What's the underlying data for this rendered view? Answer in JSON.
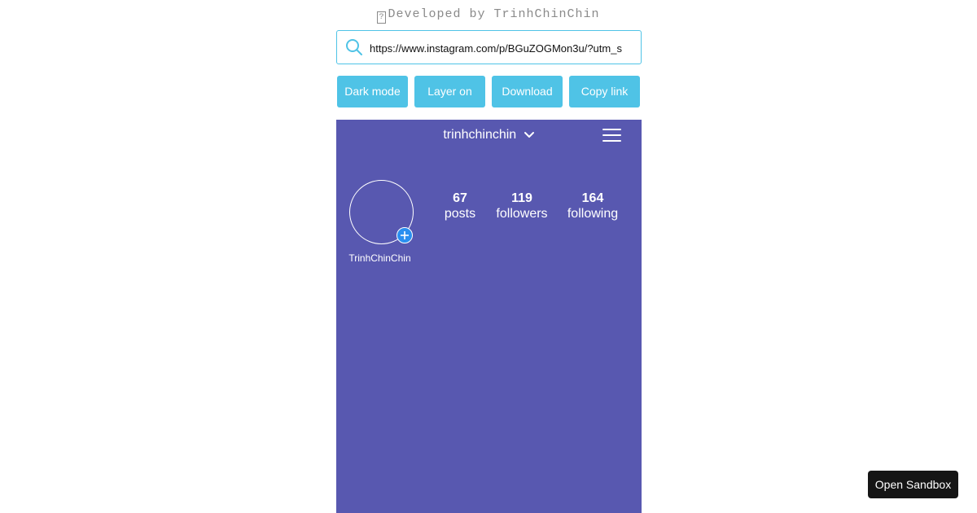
{
  "credit": {
    "glyph": "?",
    "text": "Developed by TrinhChinChin"
  },
  "url_bar": {
    "icon": "search-icon",
    "value": "https://www.instagram.com/p/BGuZOGMon3u/?utm_s",
    "accent_color": "#4fc3e6"
  },
  "toolbar": {
    "buttons": [
      {
        "label": "Dark mode"
      },
      {
        "label": "Layer on"
      },
      {
        "label": "Download"
      },
      {
        "label": "Copy link"
      }
    ]
  },
  "profile": {
    "background_color": "#5858b0",
    "username": "trinhchinchin",
    "display_name": "TrinhChinChin",
    "stats": [
      {
        "value": "67",
        "label": "posts"
      },
      {
        "value": "119",
        "label": "followers"
      },
      {
        "value": "164",
        "label": "following"
      }
    ]
  },
  "sandbox": {
    "label": "Open Sandbox"
  }
}
